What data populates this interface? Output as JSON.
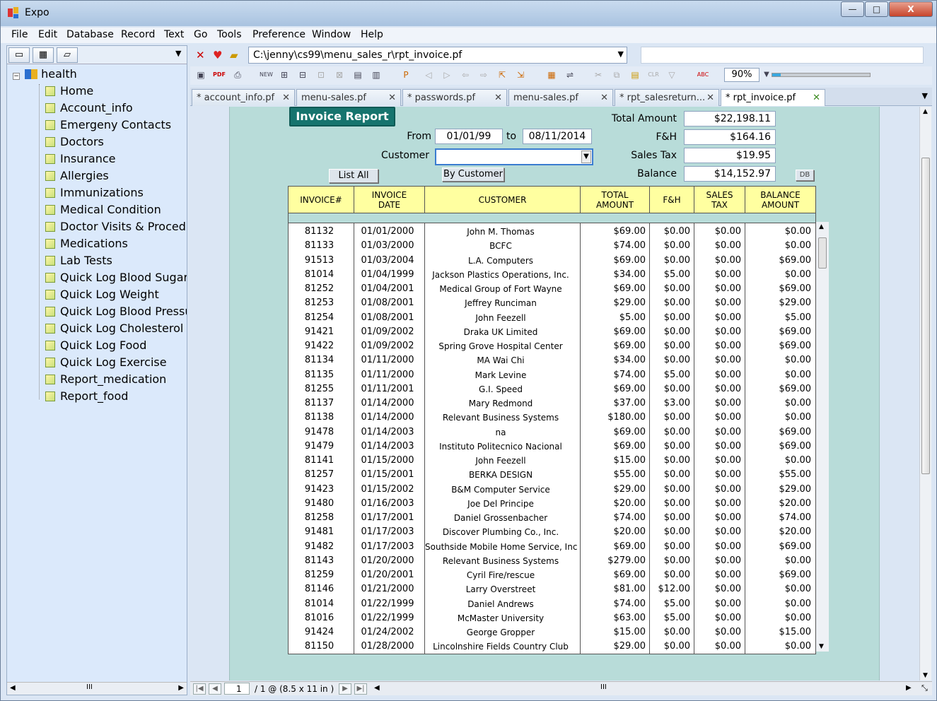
{
  "window": {
    "title": "Expo",
    "min": "—",
    "max": "□",
    "close": "X"
  },
  "menu": [
    "File",
    "Edit",
    "Database",
    "Record",
    "Text",
    "Go",
    "Tools",
    "Preference",
    "Window",
    "Help"
  ],
  "tree": {
    "root": "health",
    "items": [
      "Home",
      "Account_info",
      "Emergeny Contacts",
      "Doctors",
      "Insurance",
      "Allergies",
      "Immunizations",
      "Medical Condition",
      "Doctor Visits & Procedur",
      "Medications",
      "Lab Tests",
      "Quick Log Blood Sugar",
      "Quick Log Weight",
      "Quick Log Blood Pressur",
      "Quick Log Cholesterol",
      "Quick Log Food",
      "Quick Log Exercise",
      "Report_medication",
      "Report_food"
    ]
  },
  "address": {
    "path": "C:\\jenny\\cs99\\menu_sales_r\\rpt_invoice.pf"
  },
  "zoom": "90%",
  "tabs": [
    {
      "label": "* account_info.pf"
    },
    {
      "label": "menu-sales.pf"
    },
    {
      "label": "* passwords.pf"
    },
    {
      "label": "menu-sales.pf"
    },
    {
      "label": "* rpt_salesreturn..."
    },
    {
      "label": "* rpt_invoice.pf"
    }
  ],
  "report": {
    "title": "Invoice Report",
    "from_label": "From",
    "from_value": "01/01/99",
    "to_label": "to",
    "to_value": "08/11/2014",
    "customer_label": "Customer",
    "customer_value": "",
    "list_all": "List  All",
    "by_customer": "By Customer",
    "db_button": "DB",
    "totals": {
      "total_amount_label": "Total Amount",
      "total_amount": "$22,198.11",
      "fh_label": "F&H",
      "fh": "$164.16",
      "sales_tax_label": "Sales Tax",
      "sales_tax": "$19.95",
      "balance_label": "Balance",
      "balance": "$14,152.97"
    },
    "columns": [
      "INVOICE#",
      "INVOICE DATE",
      "CUSTOMER",
      "TOTAL AMOUNT",
      "F&H",
      "SALES TAX",
      "BALANCE AMOUNT"
    ],
    "rows": [
      [
        "81132",
        "01/01/2000",
        "John M. Thomas",
        "$69.00",
        "$0.00",
        "$0.00",
        "$0.00"
      ],
      [
        "81133",
        "01/03/2000",
        "BCFC",
        "$74.00",
        "$0.00",
        "$0.00",
        "$0.00"
      ],
      [
        "91513",
        "01/03/2004",
        "L.A. Computers",
        "$69.00",
        "$0.00",
        "$0.00",
        "$69.00"
      ],
      [
        "81014",
        "01/04/1999",
        "Jackson Plastics Operations, Inc.",
        "$34.00",
        "$5.00",
        "$0.00",
        "$0.00"
      ],
      [
        "81252",
        "01/04/2001",
        "Medical Group of Fort Wayne",
        "$69.00",
        "$0.00",
        "$0.00",
        "$69.00"
      ],
      [
        "81253",
        "01/08/2001",
        "Jeffrey Runciman",
        "$29.00",
        "$0.00",
        "$0.00",
        "$29.00"
      ],
      [
        "81254",
        "01/08/2001",
        "John Feezell",
        "$5.00",
        "$0.00",
        "$0.00",
        "$5.00"
      ],
      [
        "91421",
        "01/09/2002",
        "Draka UK Limited",
        "$69.00",
        "$0.00",
        "$0.00",
        "$69.00"
      ],
      [
        "91422",
        "01/09/2002",
        "Spring Grove Hospital Center",
        "$69.00",
        "$0.00",
        "$0.00",
        "$69.00"
      ],
      [
        "81134",
        "01/11/2000",
        "MA Wai Chi",
        "$34.00",
        "$0.00",
        "$0.00",
        "$0.00"
      ],
      [
        "81135",
        "01/11/2000",
        "Mark Levine",
        "$74.00",
        "$5.00",
        "$0.00",
        "$0.00"
      ],
      [
        "81255",
        "01/11/2001",
        "G.I. Speed",
        "$69.00",
        "$0.00",
        "$0.00",
        "$69.00"
      ],
      [
        "81137",
        "01/14/2000",
        "Mary Redmond",
        "$37.00",
        "$3.00",
        "$0.00",
        "$0.00"
      ],
      [
        "81138",
        "01/14/2000",
        "Relevant Business Systems",
        "$180.00",
        "$0.00",
        "$0.00",
        "$0.00"
      ],
      [
        "91478",
        "01/14/2003",
        "na",
        "$69.00",
        "$0.00",
        "$0.00",
        "$69.00"
      ],
      [
        "91479",
        "01/14/2003",
        "Instituto Politecnico Nacional",
        "$69.00",
        "$0.00",
        "$0.00",
        "$69.00"
      ],
      [
        "81141",
        "01/15/2000",
        "John Feezell",
        "$15.00",
        "$0.00",
        "$0.00",
        "$0.00"
      ],
      [
        "81257",
        "01/15/2001",
        "BERKA DESIGN",
        "$55.00",
        "$0.00",
        "$0.00",
        "$55.00"
      ],
      [
        "91423",
        "01/15/2002",
        "B&M Computer Service",
        "$29.00",
        "$0.00",
        "$0.00",
        "$29.00"
      ],
      [
        "91480",
        "01/16/2003",
        "Joe Del Principe",
        "$20.00",
        "$0.00",
        "$0.00",
        "$20.00"
      ],
      [
        "81258",
        "01/17/2001",
        "Daniel Grossenbacher",
        "$74.00",
        "$0.00",
        "$0.00",
        "$74.00"
      ],
      [
        "91481",
        "01/17/2003",
        "Discover Plumbing Co., Inc.",
        "$20.00",
        "$0.00",
        "$0.00",
        "$20.00"
      ],
      [
        "91482",
        "01/17/2003",
        "Southside Mobile Home Service, Inc",
        "$69.00",
        "$0.00",
        "$0.00",
        "$69.00"
      ],
      [
        "81143",
        "01/20/2000",
        "Relevant Business Systems",
        "$279.00",
        "$0.00",
        "$0.00",
        "$0.00"
      ],
      [
        "81259",
        "01/20/2001",
        "Cyril Fire/rescue",
        "$69.00",
        "$0.00",
        "$0.00",
        "$69.00"
      ],
      [
        "81146",
        "01/21/2000",
        "Larry Overstreet",
        "$81.00",
        "$12.00",
        "$0.00",
        "$0.00"
      ],
      [
        "81014",
        "01/22/1999",
        "Daniel  Andrews",
        "$74.00",
        "$5.00",
        "$0.00",
        "$0.00"
      ],
      [
        "81016",
        "01/22/1999",
        "McMaster University",
        "$63.00",
        "$5.00",
        "$0.00",
        "$0.00"
      ],
      [
        "91424",
        "01/24/2002",
        "George Gropper",
        "$15.00",
        "$0.00",
        "$0.00",
        "$15.00"
      ],
      [
        "81150",
        "01/28/2000",
        "Lincolnshire Fields Country Club",
        "$29.00",
        "$0.00",
        "$0.00",
        "$0.00"
      ]
    ]
  },
  "pager": {
    "page": "1",
    "info": "/ 1 @ (8.5 x 11 in )"
  }
}
